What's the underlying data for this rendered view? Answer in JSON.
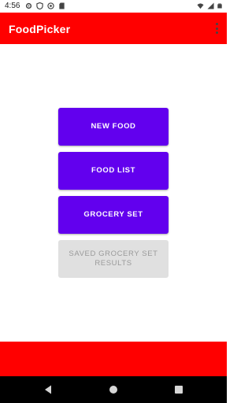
{
  "status_bar": {
    "time": "4:56",
    "left_icons": [
      "gear-icon",
      "shield-icon",
      "sync-icon",
      "sd-card-icon"
    ],
    "right_icons": [
      "wifi-icon",
      "signal-icon",
      "battery-icon"
    ]
  },
  "app_bar": {
    "title": "FoodPicker",
    "background": "#ff0000",
    "overflow_icon": "more-vert-icon"
  },
  "main": {
    "buttons": [
      {
        "label": "NEW FOOD",
        "enabled": true
      },
      {
        "label": "FOOD LIST",
        "enabled": true
      },
      {
        "label": "GROCERY SET",
        "enabled": true
      },
      {
        "label": "SAVED GROCERY SET RESULTS",
        "enabled": false
      }
    ],
    "accent": "#6200ee"
  },
  "nav_bar": {
    "items": [
      "back-icon",
      "home-icon",
      "recents-icon"
    ]
  }
}
